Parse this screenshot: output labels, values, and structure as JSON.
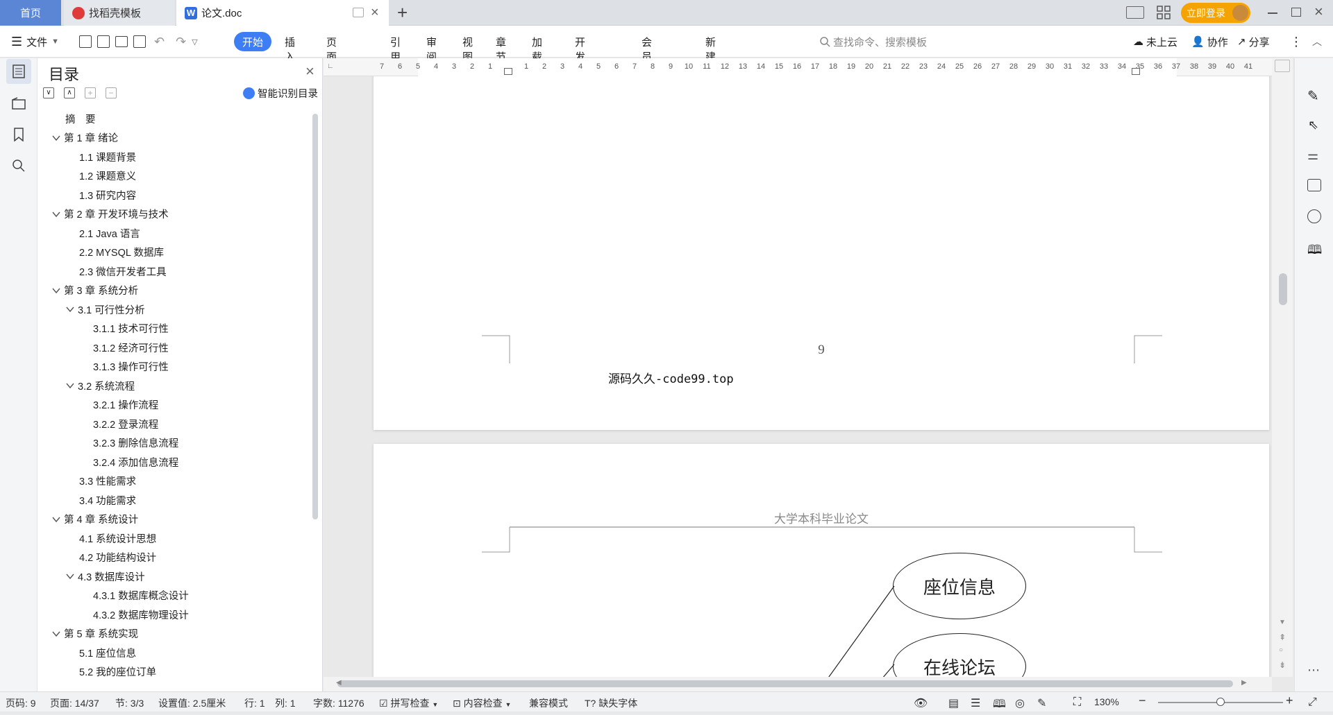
{
  "tabs": {
    "home": "首页",
    "template": "找稻壳模板",
    "doc": "论文.doc"
  },
  "topright": {
    "login": "立即登录"
  },
  "toolbar": {
    "file": "文件",
    "start": "开始",
    "menus": [
      "插入",
      "页面布局",
      "引用",
      "审阅",
      "视图",
      "章节",
      "加载项",
      "开发工具",
      "会员专享",
      "新建选项卡"
    ],
    "search_placeholder": "查找命令、搜索模板",
    "cloud": "未上云",
    "collab": "协作",
    "share": "分享"
  },
  "toc": {
    "title": "目录",
    "smart": "智能识别目录",
    "items": [
      {
        "label": "摘　要",
        "level": 0,
        "chev": false
      },
      {
        "label": "第 1 章  绪论",
        "level": 0,
        "chev": true
      },
      {
        "label": "1.1  课题背景",
        "level": 1,
        "chev": false
      },
      {
        "label": "1.2  课题意义",
        "level": 1,
        "chev": false
      },
      {
        "label": "1.3  研究内容",
        "level": 1,
        "chev": false
      },
      {
        "label": "第 2 章  开发环境与技术",
        "level": 0,
        "chev": true
      },
      {
        "label": "2.1 Java 语言",
        "level": 1,
        "chev": false
      },
      {
        "label": "2.2 MYSQL 数据库",
        "level": 1,
        "chev": false
      },
      {
        "label": "2.3 微信开发者工具",
        "level": 1,
        "chev": false
      },
      {
        "label": "第 3 章  系统分析",
        "level": 0,
        "chev": true
      },
      {
        "label": "3.1  可行性分析",
        "level": 1,
        "chev": true
      },
      {
        "label": "3.1.1  技术可行性",
        "level": 2,
        "chev": false
      },
      {
        "label": "3.1.2  经济可行性",
        "level": 2,
        "chev": false
      },
      {
        "label": "3.1.3  操作可行性",
        "level": 2,
        "chev": false
      },
      {
        "label": "3.2  系统流程",
        "level": 1,
        "chev": true
      },
      {
        "label": "3.2.1  操作流程",
        "level": 2,
        "chev": false
      },
      {
        "label": "3.2.2  登录流程",
        "level": 2,
        "chev": false
      },
      {
        "label": "3.2.3  删除信息流程",
        "level": 2,
        "chev": false
      },
      {
        "label": "3.2.4  添加信息流程",
        "level": 2,
        "chev": false
      },
      {
        "label": "3.3  性能需求",
        "level": 1,
        "chev": false
      },
      {
        "label": "3.4  功能需求",
        "level": 1,
        "chev": false
      },
      {
        "label": "第 4 章  系统设计",
        "level": 0,
        "chev": true
      },
      {
        "label": "4.1  系统设计思想",
        "level": 1,
        "chev": false
      },
      {
        "label": "4.2  功能结构设计",
        "level": 1,
        "chev": false
      },
      {
        "label": "4.3  数据库设计",
        "level": 1,
        "chev": true
      },
      {
        "label": "4.3.1  数据库概念设计",
        "level": 2,
        "chev": false
      },
      {
        "label": "4.3.2  数据库物理设计",
        "level": 2,
        "chev": false
      },
      {
        "label": "第 5 章  系统实现",
        "level": 0,
        "chev": true
      },
      {
        "label": "5.1  座位信息",
        "level": 1,
        "chev": false
      },
      {
        "label": "5.2  我的座位订单",
        "level": 1,
        "chev": false
      }
    ]
  },
  "ruler": {
    "numbers": [
      "7",
      "6",
      "5",
      "4",
      "3",
      "2",
      "1",
      "",
      "1",
      "2",
      "3",
      "4",
      "5",
      "6",
      "7",
      "8",
      "9",
      "10",
      "11",
      "12",
      "13",
      "14",
      "15",
      "16",
      "17",
      "18",
      "19",
      "20",
      "21",
      "22",
      "23",
      "24",
      "25",
      "26",
      "27",
      "28",
      "29",
      "30",
      "31",
      "32",
      "33",
      "34",
      "35",
      "36",
      "37",
      "38",
      "39",
      "40",
      "41"
    ]
  },
  "document": {
    "page_number": "9",
    "watermark": "源码久久-code99.top",
    "header": "大学本科毕业论文",
    "diagram_nodes": [
      "座位信息",
      "在线论坛"
    ]
  },
  "status": {
    "page": "页码: 9",
    "pages": "页面: 14/37",
    "section": "节: 3/3",
    "setting": "设置值: 2.5厘米",
    "row": "行: 1",
    "col": "列: 1",
    "words": "字数: 11276",
    "spell": "拼写检查",
    "content": "内容检查",
    "compat": "兼容模式",
    "missing_font": "缺失字体",
    "zoom": "130%"
  }
}
